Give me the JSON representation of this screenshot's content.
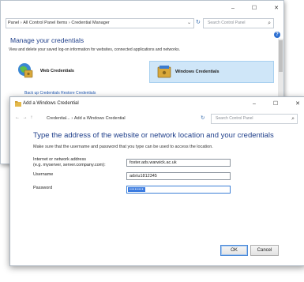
{
  "credential_manager": {
    "window_controls": {
      "minimize": "–",
      "maximize": "☐",
      "close": "✕"
    },
    "breadcrumb": [
      "Panel",
      "All Control Panel Items",
      "Credential Manager"
    ],
    "breadcrumb_separator": "›",
    "search_placeholder": "Search Control Panel",
    "title": "Manage your credentials",
    "description": "View and delete your saved log-on information for websites, connected applications and networks.",
    "web_credentials_label": "Web Credentials",
    "windows_credentials_label": "Windows Credentials",
    "links": "Back up Credentials    Restore Credentials",
    "help": "?"
  },
  "add_credential": {
    "window_title": "Add a Windows Credential",
    "window_controls": {
      "minimize": "–",
      "maximize": "☐",
      "close": "✕"
    },
    "nav": "← → ↑",
    "breadcrumb": [
      "Credential...",
      "Add a Windows Credential"
    ],
    "breadcrumb_separator": "›",
    "search_placeholder": "Search Control Panel",
    "heading": "Type the address of the website or network location and your credentials",
    "description": "Make sure that the username and password that you type can be used to access the location.",
    "fields": {
      "address_label_line1": "Internet or network address",
      "address_label_line2": "(e.g. myserver, server.company.com):",
      "address_value": "foster.ads.warwick.ac.uk",
      "username_label": "Username",
      "username_value": "ads\\u1812345",
      "password_label": "Password",
      "password_mask": "••••••••"
    },
    "ok_label": "OK",
    "cancel_label": "Cancel"
  }
}
